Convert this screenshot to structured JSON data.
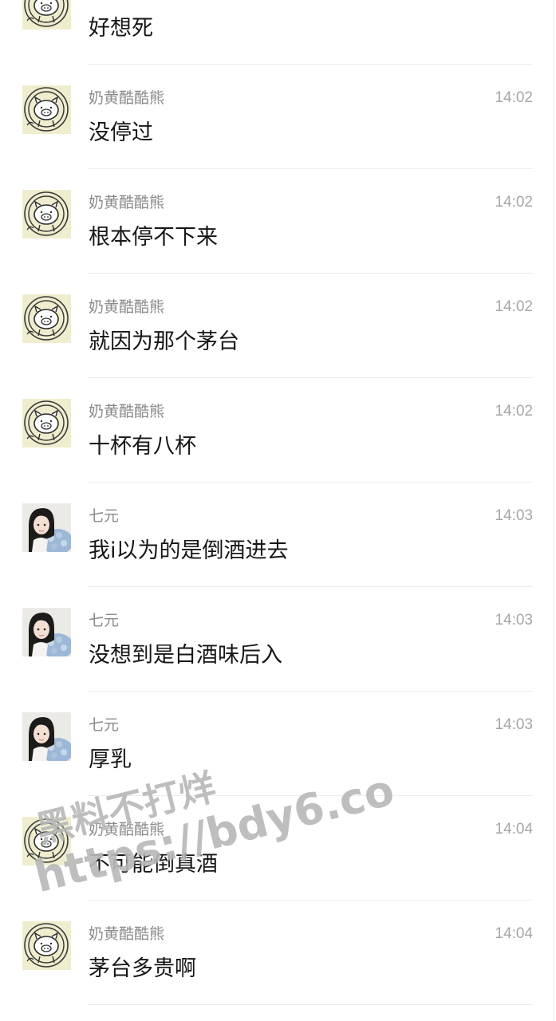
{
  "messages": [
    {
      "sender": "",
      "time": "",
      "text": "好想死",
      "avatar": "pig-sticker-avatar"
    },
    {
      "sender": "奶黄酷酷熊",
      "time": "14:02",
      "text": "没停过",
      "avatar": "pig-sticker-avatar"
    },
    {
      "sender": "奶黄酷酷熊",
      "time": "14:02",
      "text": "根本停不下来",
      "avatar": "pig-sticker-avatar"
    },
    {
      "sender": "奶黄酷酷熊",
      "time": "14:02",
      "text": "就因为那个茅台",
      "avatar": "pig-sticker-avatar"
    },
    {
      "sender": "奶黄酷酷熊",
      "time": "14:02",
      "text": "十杯有八杯",
      "avatar": "pig-sticker-avatar"
    },
    {
      "sender": "七元",
      "time": "14:03",
      "text": "我i以为的是倒酒进去",
      "avatar": "girl-photo-avatar"
    },
    {
      "sender": "七元",
      "time": "14:03",
      "text": "没想到是白酒味后入",
      "avatar": "girl-photo-avatar"
    },
    {
      "sender": "七元",
      "time": "14:03",
      "text": "厚乳",
      "avatar": "girl-photo-avatar"
    },
    {
      "sender": "奶黄酷酷熊",
      "time": "14:04",
      "text": "不可能倒真酒",
      "avatar": "pig-sticker-avatar"
    },
    {
      "sender": "奶黄酷酷熊",
      "time": "14:04",
      "text": "茅台多贵啊",
      "avatar": "pig-sticker-avatar"
    }
  ],
  "watermark": {
    "line1": "黑料不打烊",
    "line2": "https://bdy6.co"
  },
  "colors": {
    "background": "#ffffff",
    "sender": "#8a8a8a",
    "time": "#a6a6a6",
    "message": "#161616",
    "divider": "#ececec",
    "pig_avatar_bg": "#efedce"
  }
}
